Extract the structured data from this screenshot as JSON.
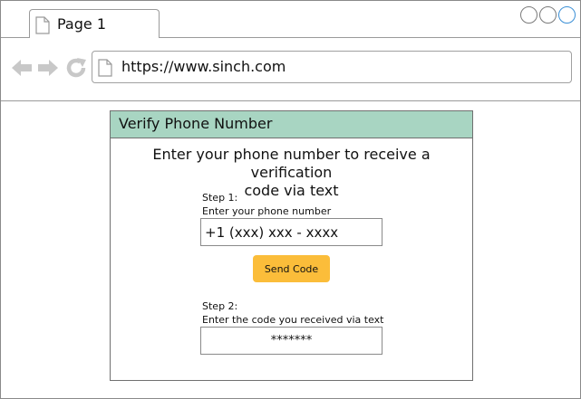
{
  "browser": {
    "tab_title": "Page 1",
    "url": "https://www.sinch.com",
    "colors": {
      "active_control": "#3b8fd6",
      "border": "#9a9a9a"
    }
  },
  "dialog": {
    "title": "Verify Phone Number",
    "intro_line1": "Enter your phone number to receive a verification",
    "intro_line2": "code via text",
    "step1": {
      "label": "Step 1:",
      "description": "Enter your phone number",
      "phone_value": "+1 (xxx) xxx - xxxx"
    },
    "send_button": "Send Code",
    "step2": {
      "label": "Step 2:",
      "description": "Enter the code you received via text",
      "code_value": "*******"
    },
    "colors": {
      "header": "#a8d5c2",
      "button": "#fbbd3a"
    }
  }
}
